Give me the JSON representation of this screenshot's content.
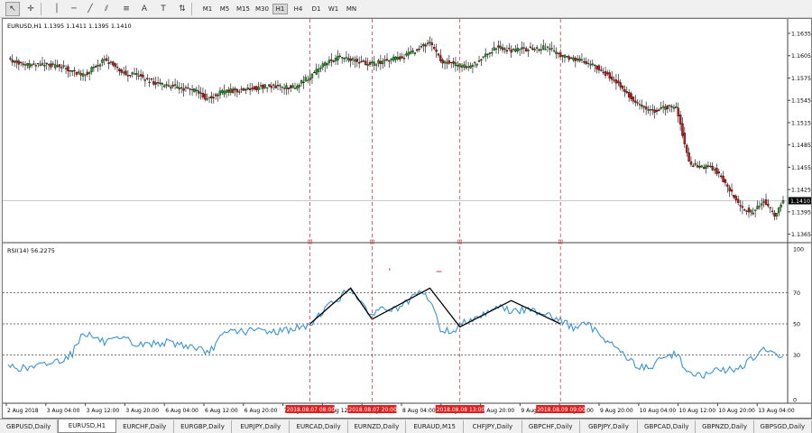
{
  "toolbar": {
    "tools": [
      {
        "name": "cursor-tool",
        "glyph": "↖",
        "active": true
      },
      {
        "name": "crosshair-tool",
        "glyph": "✛",
        "active": false
      },
      {
        "name": "vertical-line-tool",
        "glyph": "│",
        "active": false
      },
      {
        "name": "horizontal-line-tool",
        "glyph": "─",
        "active": false
      },
      {
        "name": "trendline-tool",
        "glyph": "╱",
        "active": false
      },
      {
        "name": "channel-tool",
        "glyph": "⫽",
        "active": false
      },
      {
        "name": "fibonacci-tool",
        "glyph": "≡",
        "active": false
      },
      {
        "name": "text-tool",
        "glyph": "A",
        "active": false
      },
      {
        "name": "text-label-tool",
        "glyph": "T",
        "active": false
      },
      {
        "name": "arrows-tool",
        "glyph": "⇅",
        "active": false
      }
    ],
    "timeframes": [
      "M1",
      "M5",
      "M15",
      "M30",
      "H1",
      "H4",
      "D1",
      "W1",
      "MN"
    ],
    "active_timeframe": "H1"
  },
  "chart": {
    "header": "EURUSD,H1  1.1395 1.1411 1.1395 1.1410",
    "current_price_label": "1.1410",
    "price_ticks": [
      "1.1635",
      "1.1605",
      "1.1575",
      "1.1545",
      "1.1515",
      "1.1485",
      "1.1455",
      "1.1425",
      "1.1395",
      "1.1365"
    ],
    "rsi_header": "RSI(14) 56.2275",
    "rsi_ticks": [
      "100",
      "70",
      "50",
      "30",
      "0"
    ],
    "time_labels": [
      "2 Aug 2018",
      "3 Aug 04:00",
      "3 Aug 12:00",
      "3 Aug 20:00",
      "6 Aug 04:00",
      "6 Aug 12:00",
      "6 Aug 20:00",
      "7 Aug 04:00",
      "7 Aug 12:00",
      "7 Aug 20:00",
      "8 Aug 04:00",
      "8 Aug 12:00",
      "8 Aug 20:00",
      "9 Aug 04:00",
      "9 Aug 12:00",
      "9 Aug 20:00",
      "10 Aug 04:00",
      "10 Aug 12:00",
      "10 Aug 20:00",
      "13 Aug 04:00"
    ],
    "vline_labels": [
      "2018.08.07 08:00",
      "2018.08.07 20:00",
      "2018.08.08 13:00",
      "2018.08.09 09:00"
    ],
    "colors": {
      "bull": "#1ea01e",
      "bear": "#c81414",
      "rsi": "#3a93d6",
      "zigzag": "#000000",
      "vline": "#d04040",
      "vline_label_bg": "#e02020"
    }
  },
  "chart_data": {
    "type": "candlestick",
    "symbol": "EURUSD,H1",
    "ylim": [
      1.1356,
      1.1652
    ],
    "price_ticks": [
      1.1635,
      1.1605,
      1.1575,
      1.1545,
      1.1515,
      1.1485,
      1.1455,
      1.1425,
      1.1395,
      1.1365
    ],
    "current_price": 1.141,
    "close_path": [
      [
        0,
        1.16
      ],
      [
        8,
        1.1592
      ],
      [
        15,
        1.1593
      ],
      [
        25,
        1.159
      ],
      [
        30,
        1.1585
      ],
      [
        35,
        1.1578
      ],
      [
        45,
        1.16
      ],
      [
        55,
        1.158
      ],
      [
        60,
        1.1579
      ],
      [
        65,
        1.1572
      ],
      [
        73,
        1.1565
      ],
      [
        80,
        1.1562
      ],
      [
        90,
        1.1556
      ],
      [
        92,
        1.1546
      ],
      [
        100,
        1.1556
      ],
      [
        105,
        1.1558
      ],
      [
        110,
        1.1559
      ],
      [
        118,
        1.1563
      ],
      [
        125,
        1.1564
      ],
      [
        133,
        1.1562
      ],
      [
        140,
        1.1575
      ],
      [
        148,
        1.1595
      ],
      [
        155,
        1.1603
      ],
      [
        162,
        1.1599
      ],
      [
        168,
        1.1593
      ],
      [
        175,
        1.1597
      ],
      [
        180,
        1.1601
      ],
      [
        185,
        1.1604
      ],
      [
        192,
        1.1615
      ],
      [
        197,
        1.1622
      ],
      [
        202,
        1.1598
      ],
      [
        208,
        1.1594
      ],
      [
        215,
        1.1589
      ],
      [
        222,
        1.1602
      ],
      [
        228,
        1.1617
      ],
      [
        235,
        1.1612
      ],
      [
        243,
        1.1614
      ],
      [
        252,
        1.1616
      ],
      [
        258,
        1.1605
      ],
      [
        265,
        1.16
      ],
      [
        270,
        1.1597
      ],
      [
        275,
        1.159
      ],
      [
        282,
        1.1575
      ],
      [
        288,
        1.1558
      ],
      [
        294,
        1.154
      ],
      [
        300,
        1.153
      ],
      [
        306,
        1.1535
      ],
      [
        312,
        1.1537
      ],
      [
        318,
        1.146
      ],
      [
        325,
        1.1455
      ],
      [
        330,
        1.1453
      ],
      [
        336,
        1.143
      ],
      [
        342,
        1.14
      ],
      [
        348,
        1.1395
      ],
      [
        353,
        1.141
      ],
      [
        358,
        1.139
      ],
      [
        362,
        1.141
      ]
    ],
    "rsi": {
      "ylim": [
        0,
        100
      ],
      "levels": [
        70,
        50,
        30
      ],
      "values": [
        [
          0,
          23
        ],
        [
          8,
          21
        ],
        [
          15,
          23
        ],
        [
          25,
          27
        ],
        [
          30,
          31
        ],
        [
          35,
          45
        ],
        [
          45,
          38
        ],
        [
          55,
          40
        ],
        [
          60,
          36
        ],
        [
          65,
          37
        ],
        [
          73,
          38
        ],
        [
          80,
          37
        ],
        [
          90,
          34
        ],
        [
          92,
          29
        ],
        [
          100,
          42
        ],
        [
          105,
          46
        ],
        [
          110,
          45
        ],
        [
          118,
          46
        ],
        [
          125,
          45
        ],
        [
          133,
          47
        ],
        [
          140,
          48
        ],
        [
          148,
          60
        ],
        [
          155,
          67
        ],
        [
          160,
          73
        ],
        [
          162,
          70
        ],
        [
          168,
          56
        ],
        [
          175,
          60
        ],
        [
          180,
          59
        ],
        [
          185,
          62
        ],
        [
          192,
          70
        ],
        [
          197,
          66
        ],
        [
          202,
          46
        ],
        [
          208,
          45
        ],
        [
          215,
          53
        ],
        [
          222,
          56
        ],
        [
          228,
          62
        ],
        [
          235,
          58
        ],
        [
          243,
          59
        ],
        [
          252,
          57
        ],
        [
          258,
          52
        ],
        [
          265,
          47
        ],
        [
          270,
          50
        ],
        [
          275,
          45
        ],
        [
          282,
          37
        ],
        [
          288,
          30
        ],
        [
          294,
          22
        ],
        [
          300,
          22
        ],
        [
          306,
          28
        ],
        [
          312,
          31
        ],
        [
          318,
          18
        ],
        [
          325,
          16
        ],
        [
          330,
          20
        ],
        [
          336,
          20
        ],
        [
          342,
          22
        ],
        [
          348,
          28
        ],
        [
          353,
          33
        ],
        [
          358,
          30
        ],
        [
          362,
          29
        ]
      ],
      "zigzag": [
        [
          141,
          50
        ],
        [
          160,
          73
        ],
        [
          170,
          53
        ],
        [
          197,
          73
        ],
        [
          211,
          48
        ],
        [
          235,
          65
        ],
        [
          258,
          50
        ]
      ]
    },
    "vlines_at_index": [
      141,
      170,
      211,
      258
    ]
  },
  "tabs": [
    "GBPUSD,Daily",
    "EURUSD,H1",
    "EURCHF,Daily",
    "EURGBP,Daily",
    "EURJPY,Daily",
    "EURCAD,Daily",
    "EURNZD,Daily",
    "EURAUD,M15",
    "CHFJPY,Daily",
    "GBPCHF,Daily",
    "GBPJPY,Daily",
    "GBPCAD,Daily",
    "GBPNZD,Daily",
    "GBPSGD,Daily"
  ],
  "active_tab": "EURUSD,H1"
}
